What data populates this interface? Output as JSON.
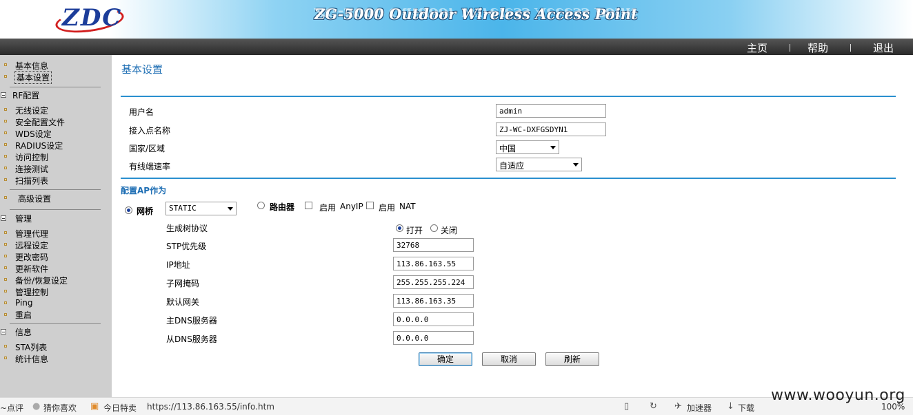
{
  "header": {
    "logo_text": "ZDC",
    "product_title": "ZG-5000 Outdoor Wireless Access Point"
  },
  "topnav": {
    "home": "主页",
    "help": "帮助",
    "logout": "退出"
  },
  "sidebar": {
    "top_items": [
      "基本信息",
      "基本设置"
    ],
    "groups": [
      {
        "title": "RF配置",
        "items": [
          "无线设定",
          "安全配置文件",
          "WDS设定",
          "RADIUS设定",
          "访问控制",
          "连接测试",
          "扫描列表"
        ]
      },
      {
        "title": "",
        "items": [
          "高级设置"
        ]
      },
      {
        "title": "管理",
        "items": [
          "管理代理",
          "远程设定",
          "更改密码",
          "更新软件",
          "备份/恢复设定",
          "管理控制",
          "Ping",
          "重启"
        ]
      },
      {
        "title": "信息",
        "items": [
          "STA列表",
          "统计信息"
        ]
      }
    ]
  },
  "main": {
    "title": "基本设置",
    "fields": {
      "username_label": "用户名",
      "username_value": "admin",
      "ap_name_label": "接入点名称",
      "ap_name_value": "ZJ-WC-DXFGSDYN1",
      "country_label": "国家/区域",
      "country_value": "中国",
      "wired_rate_label": "有线端速率",
      "wired_rate_value": "自适应"
    },
    "ap_mode": {
      "section_title": "配置AP作为",
      "bridge_label": "网桥",
      "bridge_mode_value": "STATIC",
      "router_label": "路由器",
      "enable_label_1": "启用",
      "anyip_label": "AnyIP",
      "enable_label_2": "启用",
      "nat_label": "NAT"
    },
    "bridge": {
      "stp_label": "生成树协议",
      "stp_on_label": "打开",
      "stp_off_label": "关闭",
      "stp_priority_label": "STP优先级",
      "stp_priority_value": "32768",
      "ip_label": "IP地址",
      "ip_value": "113.86.163.55",
      "mask_label": "子网掩码",
      "mask_value": "255.255.255.224",
      "gateway_label": "默认网关",
      "gateway_value": "113.86.163.35",
      "dns1_label": "主DNS服务器",
      "dns1_value": "0.0.0.0",
      "dns2_label": "从DNS服务器",
      "dns2_value": "0.0.0.0"
    },
    "buttons": {
      "ok": "确定",
      "cancel": "取消",
      "refresh": "刷新"
    }
  },
  "statusbar": {
    "left_text": "~点评",
    "guess": "猜你喜欢",
    "today": "今日特卖",
    "url": "https://113.86.163.55/info.htm",
    "accelerator": "加速器",
    "download": "下载",
    "zoom": "100%"
  },
  "watermark": "www.wooyun.org"
}
